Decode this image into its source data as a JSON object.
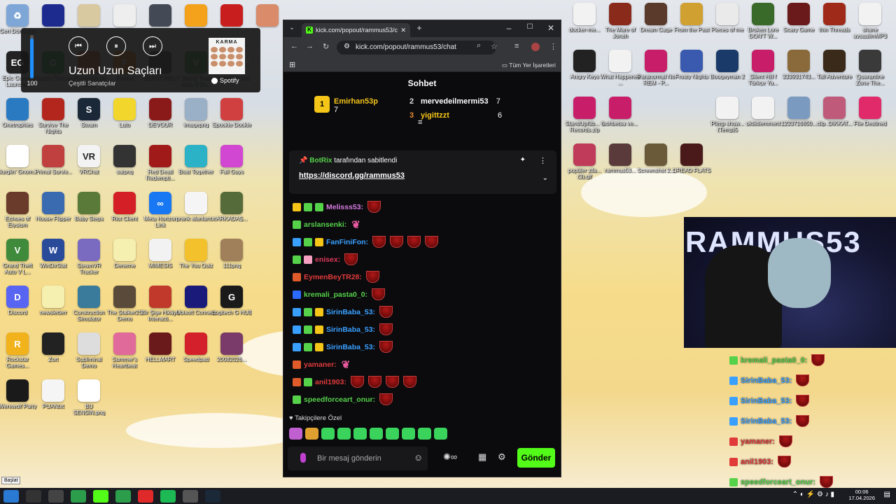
{
  "desktop_icons": [
    {
      "label": "Geri Dönüşüm",
      "color": "#7ea7d8",
      "glyph": "♻"
    },
    {
      "label": "",
      "color": "#1d2b8f",
      "glyph": ""
    },
    {
      "label": "",
      "color": "#d9c9a0",
      "glyph": ""
    },
    {
      "label": "",
      "color": "#eeeeee",
      "glyph": ""
    },
    {
      "label": "",
      "color": "#444a55",
      "glyph": ""
    },
    {
      "label": "",
      "color": "#f4a11b",
      "glyph": ""
    },
    {
      "label": "",
      "color": "#c81e1e",
      "glyph": ""
    },
    {
      "label": "",
      "color": "#d98b6a",
      "glyph": ""
    },
    {
      "label": "Epic Games Launcher",
      "color": "#222222",
      "glyph": "EG"
    },
    {
      "label": "Google Chrome",
      "color": "#2c9d4a",
      "glyph": "G"
    },
    {
      "label": "Pineapple on pizza",
      "color": "#e0561b",
      "glyph": ""
    },
    {
      "label": "Firefox",
      "color": "#ff7a1a",
      "glyph": "F"
    },
    {
      "label": "SILENT HILL f",
      "color": "#4a4a4a",
      "glyph": ""
    },
    {
      "label": "Grand Theft Auto V En...",
      "color": "#3f8a3b",
      "glyph": "V"
    },
    {
      "label": "Don't Play this",
      "color": "#8a5a2a",
      "glyph": ""
    },
    {
      "label": "Onetrophies",
      "color": "#2a7ac2",
      "glyph": ""
    },
    {
      "label": "Survive The Nights",
      "color": "#b3261e",
      "glyph": ""
    },
    {
      "label": "Steam",
      "color": "#1b2838",
      "glyph": "S"
    },
    {
      "label": "Luto",
      "color": "#f2d62b",
      "glyph": ""
    },
    {
      "label": "DEVOUR",
      "color": "#8a1a1a",
      "glyph": ""
    },
    {
      "label": "imagepng",
      "color": "#9ab0c7",
      "glyph": ""
    },
    {
      "label": "Spookie Dookie",
      "color": "#d04040",
      "glyph": ""
    },
    {
      "label": "Burglin' Gnom...",
      "color": "#ffffff",
      "glyph": ""
    },
    {
      "label": "Primal Surviv...",
      "color": "#c04040",
      "glyph": ""
    },
    {
      "label": "VRChat",
      "color": "#f3f3f3",
      "glyph": "VR"
    },
    {
      "label": "saipng",
      "color": "#333333",
      "glyph": ""
    },
    {
      "label": "Red Dead Redempti...",
      "color": "#a01a1a",
      "glyph": ""
    },
    {
      "label": "Boat Together",
      "color": "#2bb2c7",
      "glyph": ""
    },
    {
      "label": "Fall Guys",
      "color": "#d247d2",
      "glyph": ""
    },
    {
      "label": "Echoes of Elysium",
      "color": "#6a3a2a",
      "glyph": ""
    },
    {
      "label": "House Flipper",
      "color": "#3a6ab0",
      "glyph": ""
    },
    {
      "label": "Baby Steps",
      "color": "#5a7a3a",
      "glyph": ""
    },
    {
      "label": "Riot Client",
      "color": "#d41f26",
      "glyph": ""
    },
    {
      "label": "Meta Horizon Link",
      "color": "#1877f2",
      "glyph": "∞"
    },
    {
      "label": "prank alanlarıtxt",
      "color": "#f5f5f5",
      "glyph": ""
    },
    {
      "label": "ARKADAŞ...",
      "color": "#556b3a",
      "glyph": ""
    },
    {
      "label": "Grand Theft Auto V L...",
      "color": "#3f8a3b",
      "glyph": "V"
    },
    {
      "label": "WinDirStat",
      "color": "#2a4a9a",
      "glyph": "W"
    },
    {
      "label": "SteamVR Tracker",
      "color": "#7a6ac0",
      "glyph": ""
    },
    {
      "label": "Deneme",
      "color": "#f5efb0",
      "glyph": ""
    },
    {
      "label": "MIMESIS",
      "color": "#f2f2f2",
      "glyph": ""
    },
    {
      "label": "The You Quiz",
      "color": "#f2c12b",
      "glyph": ""
    },
    {
      "label": "111png",
      "color": "#a0805a",
      "glyph": ""
    },
    {
      "label": "Discord",
      "color": "#5865f2",
      "glyph": "D"
    },
    {
      "label": "newsletterr",
      "color": "#f5efb0",
      "glyph": ""
    },
    {
      "label": "Construction Simulator",
      "color": "#3a7a9a",
      "glyph": ""
    },
    {
      "label": "The Stalker2S Demo",
      "color": "#5a4a3a",
      "glyph": ""
    },
    {
      "label": "Bir Şişe Hikâye Interacti...",
      "color": "#c0392b",
      "glyph": ""
    },
    {
      "label": "Ubisoft Connect",
      "color": "#1a1a7a",
      "glyph": ""
    },
    {
      "label": "Logitech G HUB",
      "color": "#1a1a1a",
      "glyph": "G"
    },
    {
      "label": "Rockstar Games...",
      "color": "#f2b21b",
      "glyph": "R"
    },
    {
      "label": "Zort",
      "color": "#222222",
      "glyph": ""
    },
    {
      "label": "Subliminal Demo",
      "color": "#dddddd",
      "glyph": ""
    },
    {
      "label": "Summer's Heartbeat",
      "color": "#e06a9a",
      "glyph": ""
    },
    {
      "label": "HELLMART",
      "color": "#6a1a1a",
      "glyph": ""
    },
    {
      "label": "Speedpad",
      "color": "#d4202a",
      "glyph": ""
    },
    {
      "label": "20082026...",
      "color": "#7a3a6a",
      "glyph": ""
    },
    {
      "label": "Werewolf Party",
      "color": "#1a1a1a",
      "glyph": ""
    },
    {
      "label": "PUANtxt",
      "color": "#f5f5f5",
      "glyph": ""
    },
    {
      "label": "BU SENSİN.png",
      "color": "#ffffff",
      "glyph": ""
    }
  ],
  "right_icons": [
    {
      "label": "docker-me...",
      "color": "#f2f2f2"
    },
    {
      "label": "The Mare of Jonah",
      "color": "#8a2a1a"
    },
    {
      "label": "Dream Cage",
      "color": "#5a3a2a"
    },
    {
      "label": "From the Past",
      "color": "#d0a030"
    },
    {
      "label": "Pieces of me",
      "color": "#eaeaea"
    },
    {
      "label": "Broken Lore DON'T W...",
      "color": "#3a6a2a"
    },
    {
      "label": "Scary Game",
      "color": "#6a1a1a"
    },
    {
      "label": "thin Threads",
      "color": "#a02a1a"
    },
    {
      "label": "shane avsaalimMP3",
      "color": "#f2f2f2"
    },
    {
      "label": "Angry Keys",
      "color": "#222222"
    },
    {
      "label": "What Happened ...",
      "color": "#f2f2f2"
    },
    {
      "label": "Paranormal No REM - P...",
      "color": "#c81e6a"
    },
    {
      "label": "Frosty Nights",
      "color": "#3a5ab0"
    },
    {
      "label": "Boogeyman 2",
      "color": "#1a3a6a"
    },
    {
      "label": "Silent Hill f Türkçe Ya...",
      "color": "#c81e6a"
    },
    {
      "label": "333931743...",
      "color": "#8a6a3a"
    },
    {
      "label": "Tall Adventure",
      "color": "#3a2a1a"
    },
    {
      "label": "Quarantine Zone The...",
      "color": "#3a3a3a"
    },
    {
      "label": "StandUpfüb... 6 Records.zip",
      "color": "#c81e6a"
    },
    {
      "label": "sohbetsa ve...",
      "color": "#c81e6a"
    },
    {
      "label": "Plimp show... (Temp)5",
      "color": "#f2f2f2"
    },
    {
      "label": "uktikilemment",
      "color": "#f2f2f2"
    },
    {
      "label": "1233716650...",
      "color": "#7a9ac0"
    },
    {
      "label": "clip_DIKKAT...",
      "color": "#c05a7a"
    },
    {
      "label": "File Destined",
      "color": "#e02a6a"
    },
    {
      "label": "popüler zila... (3).gif",
      "color": "#c03a5a"
    },
    {
      "label": "rammus53...",
      "color": "#5a3a3a"
    },
    {
      "label": "Screenshot 2...",
      "color": "#6a5a3a"
    },
    {
      "label": "DREAD FLATS",
      "color": "#4a1a1a"
    }
  ],
  "media": {
    "volume": "100",
    "volume_level": 0.92,
    "song": "Uzun Uzun Saçları",
    "artist": "Çeşitli Sanatçılar",
    "album_text": "KARMA",
    "service": "Spotify"
  },
  "browser": {
    "tab_title": "kick.com/popout/rammus53/chat",
    "url": "kick.com/popout/rammus53/chat",
    "bookmarks_label": "Tüm Yer İşaretleri"
  },
  "chat": {
    "header": "Sohbet",
    "gifters": [
      {
        "rank": "1",
        "name": "Emirhan53p",
        "count": "7",
        "color": "#f5c518"
      },
      {
        "rank": "2",
        "name": "mervedeilmermi53",
        "count": "7",
        "color": "#ffffff"
      },
      {
        "rank": "3",
        "name": "yigittzzt",
        "count": "6",
        "color": "#f5c518"
      }
    ],
    "pinned_by": "BotRix",
    "pinned_text": "tarafından sabitlendi",
    "pinned_link": "https://discord.gg/rammus53",
    "messages": [
      {
        "user": "Melisss53:",
        "color": "#d77ae0",
        "badges": [
          "#f5c518",
          "#56d24a",
          "#56d24a"
        ],
        "cups": 1,
        "feathers": 0
      },
      {
        "user": "arslansenki:",
        "color": "#56d24a",
        "badges": [
          "#56d24a"
        ],
        "cups": 0,
        "feathers": 1
      },
      {
        "user": "FanFiniFon:",
        "color": "#3aa0ff",
        "badges": [
          "#3aa0ff",
          "#56d24a",
          "#f5c518"
        ],
        "cups": 4,
        "feathers": 0
      },
      {
        "user": "enisex:",
        "color": "#e03a5a",
        "badges": [
          "#56d24a",
          "#f5a0c0"
        ],
        "cups": 1,
        "feathers": 0
      },
      {
        "user": "EymenBeyTR28:",
        "color": "#e03a3a",
        "badges": [
          "#e05a2a"
        ],
        "cups": 1,
        "feathers": 0
      },
      {
        "user": "kremali_pasta0_0:",
        "color": "#56d24a",
        "badges": [
          "#2a6aff"
        ],
        "cups": 1,
        "feathers": 0
      },
      {
        "user": "SirinBaba_53:",
        "color": "#3aa0ff",
        "badges": [
          "#3aa0ff",
          "#56d24a",
          "#f5c518"
        ],
        "cups": 1,
        "feathers": 0
      },
      {
        "user": "SirinBaba_53:",
        "color": "#3aa0ff",
        "badges": [
          "#3aa0ff",
          "#56d24a",
          "#f5c518"
        ],
        "cups": 1,
        "feathers": 0
      },
      {
        "user": "SirinBaba_53:",
        "color": "#3aa0ff",
        "badges": [
          "#3aa0ff",
          "#56d24a",
          "#f5c518"
        ],
        "cups": 1,
        "feathers": 0
      },
      {
        "user": "yamaner:",
        "color": "#e03a3a",
        "badges": [
          "#e05a2a"
        ],
        "cups": 0,
        "feathers": 1
      },
      {
        "user": "anil1903:",
        "color": "#e03a3a",
        "badges": [
          "#e05a2a",
          "#56d24a"
        ],
        "cups": 4,
        "feathers": 0
      },
      {
        "user": "speedforceart_onur:",
        "color": "#56d24a",
        "badges": [
          "#56d24a"
        ],
        "cups": 1,
        "feathers": 0
      }
    ],
    "followers_label": "Takipçilere Özel",
    "input_placeholder": "Bir mesaj gönderin",
    "send_label": "Gönder"
  },
  "stream": {
    "banner_text": "RAMMUS53",
    "overlay_messages": [
      {
        "user": "kremali_pasta0_0:",
        "color": "#56d24a"
      },
      {
        "user": "SirinBaba_53:",
        "color": "#3aa0ff"
      },
      {
        "user": "SirinBaba_53:",
        "color": "#3aa0ff"
      },
      {
        "user": "SirinBaba_53:",
        "color": "#3aa0ff"
      },
      {
        "user": "yamaner:",
        "color": "#e03a3a"
      },
      {
        "user": "anil1903:",
        "color": "#e03a3a"
      },
      {
        "user": "speedforceart_onur:",
        "color": "#56d24a"
      }
    ]
  },
  "taskbar": {
    "start_tooltip": "Başlat",
    "time": "00:06",
    "date": "17.04.2026",
    "apps": [
      "windows-icon",
      "search-icon",
      "task-view-icon",
      "chrome-icon",
      "kick-icon",
      "chrome-icon",
      "youtube-icon",
      "spotify-icon",
      "obs-icon",
      "steam-icon"
    ]
  }
}
